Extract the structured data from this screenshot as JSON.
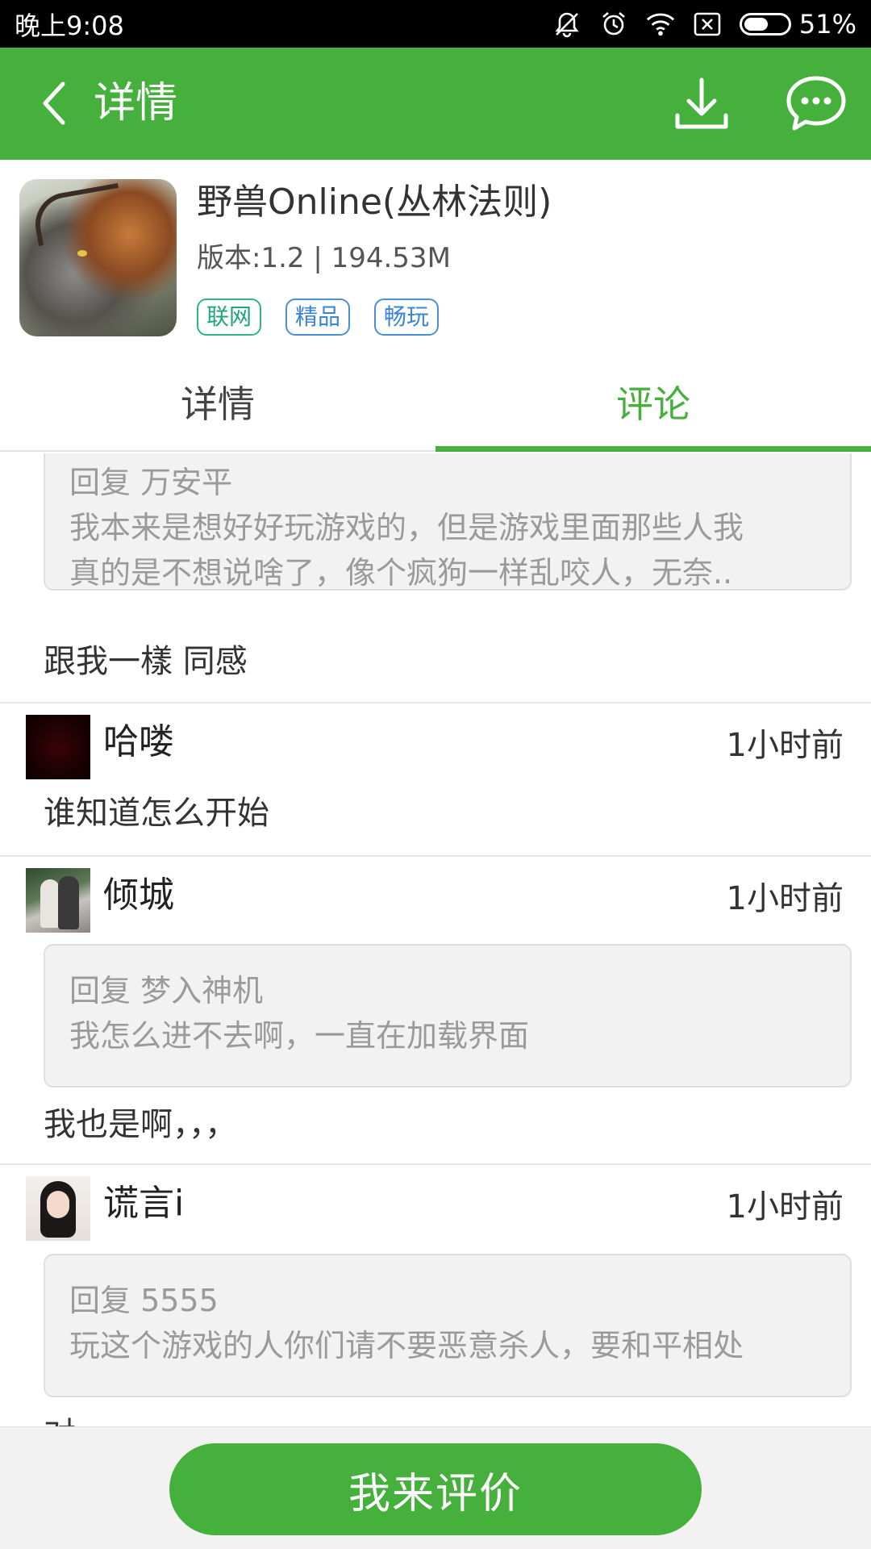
{
  "status_bar": {
    "time": "晚上9:08",
    "battery": "51%",
    "battery_level": 0.51,
    "icons": [
      "mute-icon",
      "alarm-icon",
      "wifi-icon",
      "sim-icon",
      "battery-icon"
    ]
  },
  "app_bar": {
    "title": "详情",
    "icons": [
      "back-arrow-icon",
      "download-icon",
      "message-icon"
    ]
  },
  "app_info": {
    "name": "野兽Online(丛林法则)",
    "meta": "版本:1.2 | 194.53M",
    "tags": [
      "联网",
      "精品",
      "畅玩"
    ]
  },
  "tabs": {
    "items": [
      "详情",
      "评论"
    ],
    "active": "评论"
  },
  "comments": [
    {
      "reply_header": "回复 万安平",
      "reply_lines": [
        "我本来是想好好玩游戏的，但是游戏里面那些人我",
        "真的是不想说啥了，像个疯狗一样乱咬人，无奈.."
      ],
      "text": "跟我一樣  同感"
    },
    {
      "username": "哈喽",
      "time": "1小时前",
      "text": "谁知道怎么开始"
    },
    {
      "username": "倾城",
      "time": "1小时前",
      "reply_header": "回复 梦入神机",
      "reply_lines": [
        "我怎么进不去啊，一直在加载界面"
      ],
      "text": "我也是啊，，，"
    },
    {
      "username": "谎言i",
      "time": "1小时前",
      "reply_header": "回复 5555",
      "reply_lines": [
        "玩这个游戏的人你们请不要恶意杀人，要和平相处"
      ],
      "text": "对"
    }
  ],
  "bottom": {
    "rate_button": "我来评价"
  },
  "colors": {
    "accent": "#46b03c",
    "tag_blue": "#4a90d9",
    "tag_green": "#2fb58a",
    "reply_bg": "#f2f2f2"
  }
}
